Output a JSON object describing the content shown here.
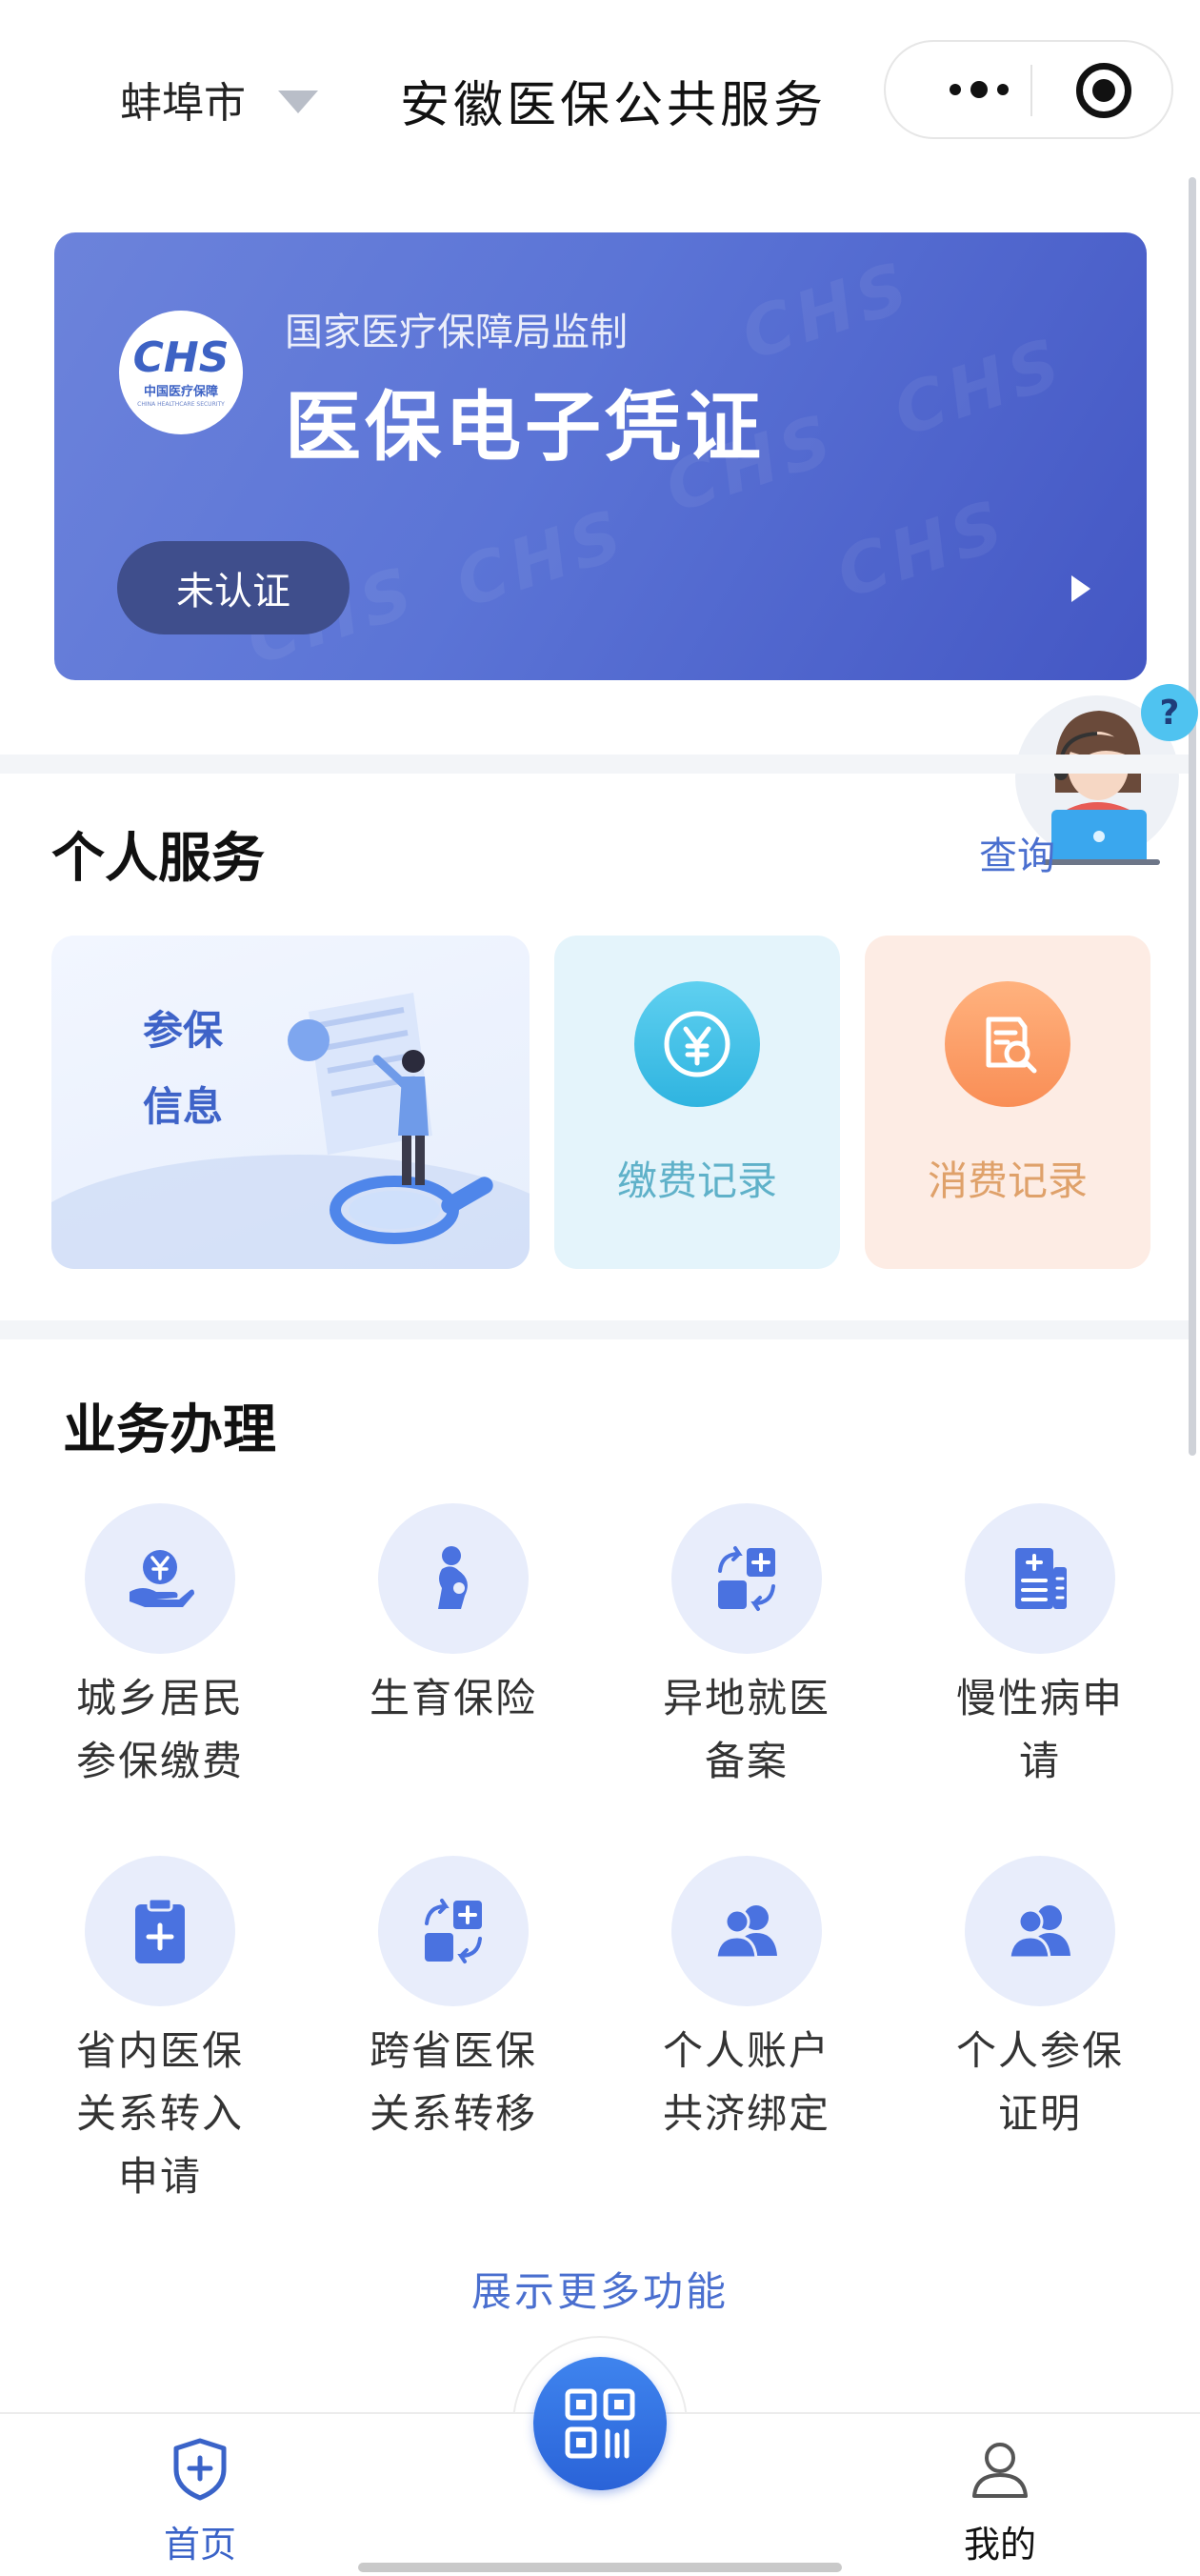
{
  "header": {
    "city": "蚌埠市",
    "title": "安徽医保公共服务"
  },
  "banner": {
    "logo_mark": "CHS",
    "logo_cn": "中国医疗保障",
    "logo_en": "CHINA HEALTHCARE SECURITY",
    "supervise": "国家医疗保障局监制",
    "title": "医保电子凭证",
    "status": "未认证",
    "bg_color": "#5b74d6"
  },
  "personal": {
    "title": "个人服务",
    "query_link": "查询",
    "insurance_info": [
      "参保",
      "信息"
    ],
    "payment_record": "缴费记录",
    "spending_record": "消费记录"
  },
  "business": {
    "title": "业务办理",
    "items": [
      {
        "label": "城乡居民\n参保缴费",
        "icon": "yuan-hand-icon"
      },
      {
        "label": "生育保险",
        "icon": "maternity-icon"
      },
      {
        "label": "异地就医\n备案",
        "icon": "medical-transfer-icon"
      },
      {
        "label": "慢性病申\n请",
        "icon": "medical-document-icon"
      },
      {
        "label": "省内医保\n关系转入\n申请",
        "icon": "clipboard-plus-icon"
      },
      {
        "label": "跨省医保\n关系转移",
        "icon": "medical-transfer-icon"
      },
      {
        "label": "个人账户\n共济绑定",
        "icon": "users-icon"
      },
      {
        "label": "个人参保\n证明",
        "icon": "users-icon"
      }
    ],
    "show_more": "展示更多功能"
  },
  "tabbar": {
    "home": "首页",
    "mine": "我的",
    "active_color": "#3a63c8"
  }
}
